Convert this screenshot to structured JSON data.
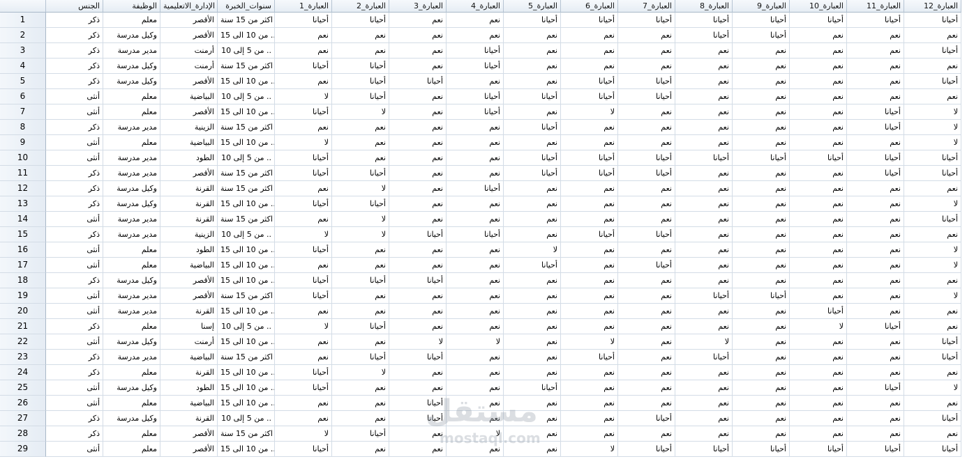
{
  "columns": [
    "الجنس",
    "الوظيفة",
    "الإدارة_الاتعليمية",
    "سنوات_الخبرة",
    "العبارة_1",
    "العبارة_2",
    "العبارة_3",
    "العبارة_4",
    "العبارة_5",
    "العبارة_6",
    "العبارة_7",
    "العبارة_8",
    "العبارة_9",
    "العبارة_10",
    "العبارة_11",
    "العبارة_12"
  ],
  "rows": [
    {
      "n": "1",
      "c": [
        "ذكر",
        "معلم",
        "الأقصر",
        "اكثر من 15 سنة",
        "أحيانا",
        "أحيانا",
        "نعم",
        "نعم",
        "أحيانا",
        "أحيانا",
        "أحيانا",
        "أحيانا",
        "أحيانا",
        "أحيانا",
        "أحيانا",
        "أحيانا"
      ]
    },
    {
      "n": "2",
      "c": [
        "ذكر",
        "وكيل مدرسة",
        "الأقصر",
        "من 10 الى 15 ..",
        "نعم",
        "نعم",
        "نعم",
        "نعم",
        "نعم",
        "نعم",
        "نعم",
        "أحيانا",
        "أحيانا",
        "نعم",
        "نعم",
        "نعم"
      ]
    },
    {
      "n": "3",
      "c": [
        "ذكر",
        "مدير مدرسة",
        "أرمنت",
        "من 5 إلى 10 ..",
        "نعم",
        "نعم",
        "نعم",
        "أحيانا",
        "نعم",
        "نعم",
        "نعم",
        "نعم",
        "نعم",
        "نعم",
        "نعم",
        "أحيانا"
      ]
    },
    {
      "n": "4",
      "c": [
        "ذكر",
        "وكيل مدرسة",
        "أرمنت",
        "اكثر من 15 سنة",
        "أحيانا",
        "أحيانا",
        "نعم",
        "أحيانا",
        "نعم",
        "نعم",
        "نعم",
        "نعم",
        "نعم",
        "نعم",
        "نعم",
        "نعم"
      ]
    },
    {
      "n": "5",
      "c": [
        "ذكر",
        "وكيل مدرسة",
        "الأقصر",
        "من 10 الى 15 ..",
        "نعم",
        "أحيانا",
        "أحيانا",
        "نعم",
        "نعم",
        "أحيانا",
        "أحيانا",
        "نعم",
        "نعم",
        "نعم",
        "نعم",
        "أحيانا"
      ]
    },
    {
      "n": "6",
      "c": [
        "أنثى",
        "معلم",
        "البياضية",
        "من 5 إلى 10 ..",
        "لا",
        "أحيانا",
        "نعم",
        "أحيانا",
        "أحيانا",
        "أحيانا",
        "أحيانا",
        "نعم",
        "نعم",
        "نعم",
        "نعم",
        "نعم"
      ]
    },
    {
      "n": "7",
      "c": [
        "أنثى",
        "معلم",
        "الأقصر",
        "من 10 الى 15 ..",
        "أحيانا",
        "لا",
        "نعم",
        "أحيانا",
        "نعم",
        "لا",
        "نعم",
        "نعم",
        "نعم",
        "نعم",
        "أحيانا",
        "لا"
      ]
    },
    {
      "n": "8",
      "c": [
        "ذكر",
        "مدير مدرسة",
        "الزينية",
        "اكثر من 15 سنة",
        "نعم",
        "نعم",
        "نعم",
        "نعم",
        "أحيانا",
        "نعم",
        "نعم",
        "نعم",
        "نعم",
        "نعم",
        "أحيانا",
        "لا"
      ]
    },
    {
      "n": "9",
      "c": [
        "أنثى",
        "معلم",
        "البياضية",
        "من 10 الى 15 ..",
        "لا",
        "نعم",
        "نعم",
        "نعم",
        "نعم",
        "نعم",
        "نعم",
        "نعم",
        "نعم",
        "نعم",
        "نعم",
        "لا"
      ]
    },
    {
      "n": "10",
      "c": [
        "أنثى",
        "مدير مدرسة",
        "الطود",
        "من 5 إلى 10 ..",
        "أحيانا",
        "نعم",
        "نعم",
        "نعم",
        "أحيانا",
        "أحيانا",
        "أحيانا",
        "أحيانا",
        "أحيانا",
        "أحيانا",
        "أحيانا",
        "أحيانا"
      ]
    },
    {
      "n": "11",
      "c": [
        "ذكر",
        "مدير مدرسة",
        "الأقصر",
        "اكثر من 15 سنة",
        "أحيانا",
        "أحيانا",
        "نعم",
        "نعم",
        "أحيانا",
        "أحيانا",
        "أحيانا",
        "نعم",
        "نعم",
        "نعم",
        "أحيانا",
        "أحيانا"
      ]
    },
    {
      "n": "12",
      "c": [
        "ذكر",
        "وكيل مدرسة",
        "القرنة",
        "اكثر من 15 سنة",
        "نعم",
        "لا",
        "نعم",
        "أحيانا",
        "نعم",
        "نعم",
        "نعم",
        "نعم",
        "نعم",
        "نعم",
        "نعم",
        "نعم"
      ]
    },
    {
      "n": "13",
      "c": [
        "ذكر",
        "وكيل مدرسة",
        "القرنة",
        "من 10 الى 15 ..",
        "أحيانا",
        "أحيانا",
        "نعم",
        "نعم",
        "نعم",
        "نعم",
        "نعم",
        "نعم",
        "نعم",
        "نعم",
        "نعم",
        "لا"
      ]
    },
    {
      "n": "14",
      "c": [
        "أنثى",
        "مدير مدرسة",
        "القرنة",
        "اكثر من 15 سنة",
        "نعم",
        "لا",
        "نعم",
        "نعم",
        "نعم",
        "نعم",
        "نعم",
        "نعم",
        "نعم",
        "نعم",
        "نعم",
        "أحيانا"
      ]
    },
    {
      "n": "15",
      "c": [
        "ذكر",
        "مدير مدرسة",
        "الزينية",
        "من 5 إلى 10 ..",
        "لا",
        "لا",
        "أحيانا",
        "أحيانا",
        "نعم",
        "أحيانا",
        "أحيانا",
        "نعم",
        "نعم",
        "نعم",
        "نعم",
        "نعم"
      ]
    },
    {
      "n": "16",
      "c": [
        "أنثى",
        "معلم",
        "الطود",
        "من 10 الى 15 ..",
        "أحيانا",
        "نعم",
        "نعم",
        "نعم",
        "لا",
        "نعم",
        "نعم",
        "نعم",
        "نعم",
        "نعم",
        "نعم",
        "لا"
      ]
    },
    {
      "n": "17",
      "c": [
        "أنثى",
        "معلم",
        "البياضية",
        "من 10 الى 15 ..",
        "نعم",
        "نعم",
        "نعم",
        "نعم",
        "أحيانا",
        "نعم",
        "أحيانا",
        "نعم",
        "نعم",
        "نعم",
        "نعم",
        "لا"
      ]
    },
    {
      "n": "18",
      "c": [
        "ذكر",
        "وكيل مدرسة",
        "الأقصر",
        "من 10 الى 15 ..",
        "أحيانا",
        "أحيانا",
        "أحيانا",
        "نعم",
        "نعم",
        "نعم",
        "نعم",
        "نعم",
        "نعم",
        "نعم",
        "نعم",
        "نعم"
      ]
    },
    {
      "n": "19",
      "c": [
        "أنثى",
        "مدير مدرسة",
        "الأقصر",
        "اكثر من 15 سنة",
        "أحيانا",
        "نعم",
        "نعم",
        "نعم",
        "نعم",
        "نعم",
        "نعم",
        "أحيانا",
        "أحيانا",
        "نعم",
        "نعم",
        "لا"
      ]
    },
    {
      "n": "20",
      "c": [
        "أنثى",
        "مدير مدرسة",
        "القرنة",
        "من 10 الى 15 ..",
        "نعم",
        "نعم",
        "نعم",
        "نعم",
        "نعم",
        "نعم",
        "نعم",
        "نعم",
        "نعم",
        "أحيانا",
        "نعم",
        "نعم"
      ]
    },
    {
      "n": "21",
      "c": [
        "ذكر",
        "معلم",
        "إسنا",
        "من 5 إلى 10 ..",
        "لا",
        "أحيانا",
        "نعم",
        "نعم",
        "نعم",
        "نعم",
        "نعم",
        "نعم",
        "نعم",
        "لا",
        "أحيانا",
        "نعم"
      ]
    },
    {
      "n": "22",
      "c": [
        "أنثى",
        "وكيل مدرسة",
        "أرمنت",
        "من 10 الى 15 ..",
        "نعم",
        "نعم",
        "لا",
        "لا",
        "نعم",
        "لا",
        "نعم",
        "لا",
        "نعم",
        "نعم",
        "نعم",
        "أحيانا"
      ]
    },
    {
      "n": "23",
      "c": [
        "ذكر",
        "مدير مدرسة",
        "البياضية",
        "اكثر من 15 سنة",
        "نعم",
        "أحيانا",
        "أحيانا",
        "نعم",
        "نعم",
        "أحيانا",
        "نعم",
        "أحيانا",
        "نعم",
        "نعم",
        "نعم",
        "أحيانا"
      ]
    },
    {
      "n": "24",
      "c": [
        "ذكر",
        "معلم",
        "القرنة",
        "من 10 الى 15 ..",
        "أحيانا",
        "لا",
        "نعم",
        "نعم",
        "نعم",
        "نعم",
        "نعم",
        "نعم",
        "نعم",
        "نعم",
        "نعم",
        "نعم"
      ]
    },
    {
      "n": "25",
      "c": [
        "أنثى",
        "وكيل مدرسة",
        "الطود",
        "من 10 الى 15 ..",
        "أحيانا",
        "نعم",
        "نعم",
        "نعم",
        "أحيانا",
        "نعم",
        "نعم",
        "نعم",
        "نعم",
        "نعم",
        "أحيانا",
        "لا"
      ]
    },
    {
      "n": "26",
      "c": [
        "أنثى",
        "معلم",
        "البياضية",
        "من 10 الى 15 ..",
        "نعم",
        "نعم",
        "أحيانا",
        "نعم",
        "نعم",
        "نعم",
        "نعم",
        "نعم",
        "نعم",
        "نعم",
        "نعم",
        "نعم"
      ]
    },
    {
      "n": "27",
      "c": [
        "ذكر",
        "وكيل مدرسة",
        "القرنة",
        "من 5 إلى 10 ..",
        "نعم",
        "نعم",
        "أحيانا",
        "نعم",
        "نعم",
        "نعم",
        "أحيانا",
        "نعم",
        "نعم",
        "نعم",
        "نعم",
        "أحيانا"
      ]
    },
    {
      "n": "28",
      "c": [
        "ذكر",
        "معلم",
        "الأقصر",
        "اكثر من 15 سنة",
        "لا",
        "أحيانا",
        "نعم",
        "لا",
        "نعم",
        "نعم",
        "نعم",
        "نعم",
        "نعم",
        "نعم",
        "نعم",
        "نعم"
      ]
    },
    {
      "n": "29",
      "c": [
        "أنثى",
        "معلم",
        "الأقصر",
        "من 10 الى 15 ..",
        "أحيانا",
        "نعم",
        "نعم",
        "نعم",
        "نعم",
        "لا",
        "أحيانا",
        "أحيانا",
        "أحيانا",
        "أحيانا",
        "أحيانا",
        "أحيانا"
      ]
    }
  ],
  "watermark": {
    "logo": "مستقل",
    "site": "mostaql.com"
  }
}
